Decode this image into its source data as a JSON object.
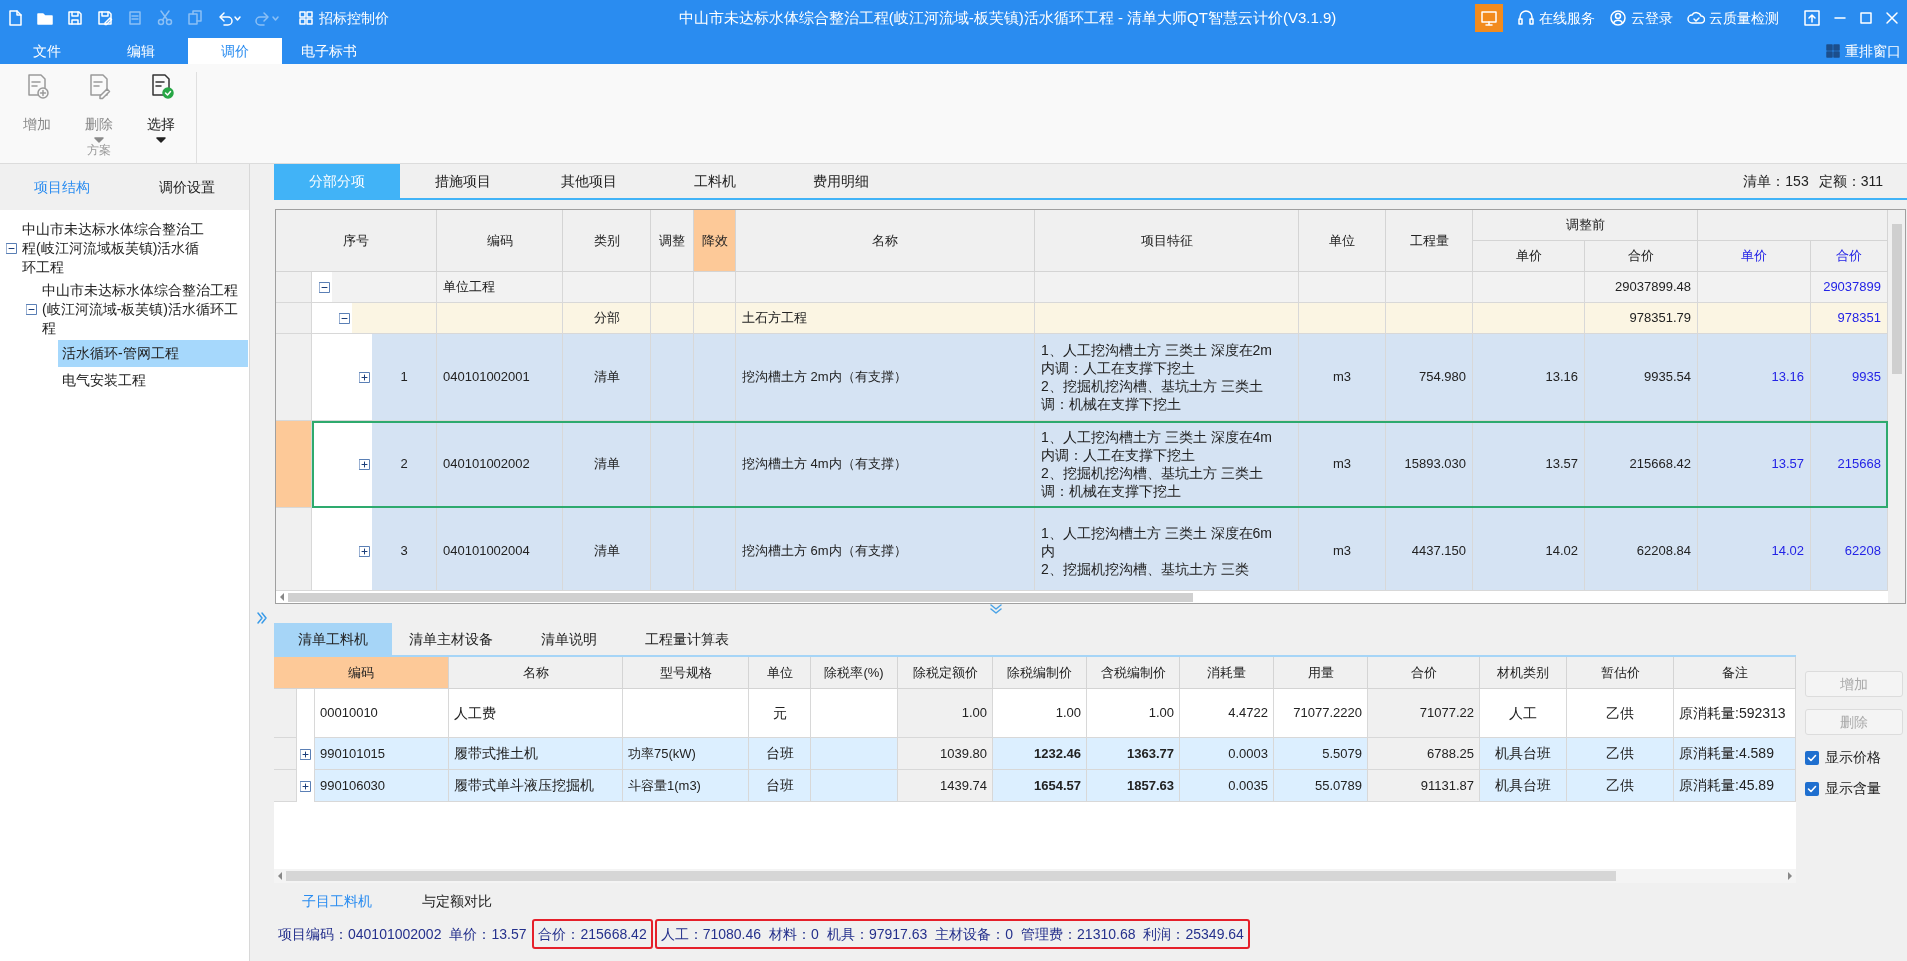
{
  "title_bar": {
    "quick_tools": [
      {
        "kind": "new",
        "disabled": false
      },
      {
        "kind": "open",
        "disabled": false
      },
      {
        "kind": "save",
        "disabled": false
      },
      {
        "kind": "save_as",
        "disabled": false
      },
      {
        "kind": "document",
        "disabled": true
      },
      {
        "kind": "cut",
        "disabled": true
      },
      {
        "kind": "copy",
        "disabled": true
      },
      {
        "kind": "undo",
        "disabled": false
      },
      {
        "kind": "redo",
        "disabled": true
      }
    ],
    "control_price_button": "招标控制价",
    "title": "中山市未达标水体综合整治工程(岐江河流域-板芙镇)活水循环工程 - 清单大师QT智慧云计价(V3.1.9)",
    "links": [
      {
        "kind": "service",
        "label": "在线服务"
      },
      {
        "kind": "login",
        "label": "云登录"
      },
      {
        "kind": "quality",
        "label": "云质量检测"
      }
    ]
  },
  "menu": {
    "tabs": [
      {
        "label": "文件",
        "selected": false
      },
      {
        "label": "编辑",
        "selected": false
      },
      {
        "label": "调价",
        "selected": true
      },
      {
        "label": "电子标书",
        "selected": false
      }
    ],
    "arrange_button": "重排窗口"
  },
  "ribbon": {
    "buttons": [
      {
        "kind": "add",
        "label": "增加",
        "disabled": true,
        "dropdown": false
      },
      {
        "kind": "delete",
        "label": "删除",
        "disabled": true,
        "dropdown": true
      },
      {
        "kind": "select",
        "label": "选择",
        "disabled": false,
        "dropdown": true
      }
    ],
    "group_label": "方案"
  },
  "sidebar": {
    "tabs": [
      {
        "label": "项目结构",
        "selected": true
      },
      {
        "label": "调价设置",
        "selected": false
      }
    ],
    "tree": [
      {
        "label": "中山市未达标水体综合整治工程(岐江河流域板芙镇)活水循环工程",
        "expanded": true,
        "selected": false,
        "children": [
          {
            "label": "中山市未达标水体综合整治工程(岐江河流域-板芙镇)活水循环工程",
            "expanded": true,
            "selected": false,
            "children": [
              {
                "label": "活水循环-管网工程",
                "selected": true
              },
              {
                "label": "电气安装工程",
                "selected": false
              }
            ]
          }
        ]
      }
    ]
  },
  "main_tabs": [
    {
      "label": "分部分项",
      "selected": true
    },
    {
      "label": "措施项目",
      "selected": false
    },
    {
      "label": "其他项目",
      "selected": false
    },
    {
      "label": "工料机",
      "selected": false
    },
    {
      "label": "费用明细",
      "selected": false
    }
  ],
  "counts": [
    "清单：153",
    "定额：311"
  ],
  "table": {
    "columns": [
      {
        "label": "序号",
        "highlighted": false
      },
      {
        "label": "编码",
        "highlighted": false
      },
      {
        "label": "类别",
        "highlighted": false
      },
      {
        "label": "调整",
        "highlighted": false
      },
      {
        "label": "降效",
        "highlighted": true
      },
      {
        "label": "名称",
        "highlighted": false
      },
      {
        "label": "项目特征",
        "highlighted": false
      },
      {
        "label": "单位",
        "highlighted": false
      },
      {
        "label": "工程量",
        "highlighted": false
      }
    ],
    "groups": [
      {
        "kind": "before",
        "label": "调整前",
        "sub": [
          "单价",
          "合价"
        ]
      },
      {
        "kind": "after",
        "sub": [
          "单价",
          "合价"
        ]
      }
    ],
    "rows": [
      {
        "kind": "unit",
        "expanded": true,
        "selected": false,
        "code": "单位工程",
        "total_before": "29037899.48",
        "total_after": "29037899",
        "children": [
          {
            "kind": "division",
            "expanded": true,
            "selected": false,
            "category": "分部",
            "name": "土石方工程",
            "total_before": "978351.79",
            "total_after": "978351",
            "children": [
              {
                "kind": "item",
                "expanded": false,
                "selected": false,
                "seq": "1",
                "code": "040101002001",
                "category": "清单",
                "name": "挖沟槽土方 2m内（有支撑）",
                "features": "1、人工挖沟槽土方 三类土 深度在2m内调：人工在支撑下挖土\n2、挖掘机挖沟槽、基坑土方 三类土调：机械在支撑下挖土",
                "unit": "m3",
                "quantity": "754.980",
                "price_before": "13.16",
                "total_before": "9935.54",
                "price_after": "13.16",
                "total_after": "9935"
              },
              {
                "kind": "item",
                "expanded": false,
                "selected": true,
                "seq": "2",
                "code": "040101002002",
                "category": "清单",
                "name": "挖沟槽土方 4m内（有支撑）",
                "features": "1、人工挖沟槽土方 三类土 深度在4m内调：人工在支撑下挖土\n2、挖掘机挖沟槽、基坑土方 三类土调：机械在支撑下挖土",
                "unit": "m3",
                "quantity": "15893.030",
                "price_before": "13.57",
                "total_before": "215668.42",
                "price_after": "13.57",
                "total_after": "215668"
              },
              {
                "kind": "item",
                "expanded": false,
                "selected": false,
                "seq": "3",
                "code": "040101002004",
                "category": "清单",
                "name": "挖沟槽土方 6m内（有支撑）",
                "features": "1、人工挖沟槽土方 三类土 深度在6m内\n2、挖掘机挖沟槽、基坑土方 三类",
                "unit": "m3",
                "quantity": "4437.150",
                "price_before": "14.02",
                "total_before": "62208.84",
                "price_after": "14.02",
                "total_after": "62208"
              }
            ]
          }
        ]
      }
    ]
  },
  "detail_tabs": [
    {
      "label": "清单工料机",
      "selected": true
    },
    {
      "label": "清单主材设备",
      "selected": false
    },
    {
      "label": "清单说明",
      "selected": false
    },
    {
      "label": "工程量计算表",
      "selected": false
    }
  ],
  "detail_table": {
    "columns": [
      {
        "label": "编码",
        "highlighted": true
      },
      {
        "label": "名称",
        "highlighted": false
      },
      {
        "label": "型号规格",
        "highlighted": false
      },
      {
        "label": "单位",
        "highlighted": false
      },
      {
        "label": "除税率(%)",
        "highlighted": false
      },
      {
        "label": "除税定额价",
        "highlighted": false
      },
      {
        "label": "除税编制价",
        "highlighted": false
      },
      {
        "label": "含税编制价",
        "highlighted": false
      },
      {
        "label": "消耗量",
        "highlighted": false
      },
      {
        "label": "用量",
        "highlighted": false
      },
      {
        "label": "合价",
        "highlighted": false
      },
      {
        "label": "材机类别",
        "highlighted": false
      },
      {
        "label": "暂估价",
        "highlighted": false
      },
      {
        "label": "备注",
        "highlighted": false
      }
    ],
    "rows": [
      {
        "kind": "labor",
        "code": "00010010",
        "name": "人工费",
        "unit": "元",
        "base_price": "1.00",
        "price_ex_tax": "1.00",
        "price_in_tax": "1.00",
        "consumption": "4.4722",
        "usage": "71077.2220",
        "total": "71077.22",
        "material_type": "人工",
        "provisional": "乙供",
        "remark": "原消耗量:592313"
      },
      {
        "kind": "machine",
        "expanded": false,
        "code": "990101015",
        "name": "履带式推土机",
        "spec": "功率75(kW)",
        "unit": "台班",
        "base_price": "1039.80",
        "price_ex_tax": "1232.46",
        "price_in_tax": "1363.77",
        "consumption": "0.0003",
        "usage": "5.5079",
        "total": "6788.25",
        "material_type": "机具台班",
        "provisional": "乙供",
        "remark": "原消耗量:4.589"
      },
      {
        "kind": "machine",
        "expanded": false,
        "code": "990106030",
        "name": "履带式单斗液压挖掘机",
        "spec": "斗容量1(m3)",
        "unit": "台班",
        "base_price": "1439.74",
        "price_ex_tax": "1654.57",
        "price_in_tax": "1857.63",
        "consumption": "0.0035",
        "usage": "55.0789",
        "total": "91131.87",
        "material_type": "机具台班",
        "provisional": "乙供",
        "remark": "原消耗量:45.89"
      }
    ]
  },
  "side_buttons": [
    {
      "label": "增加",
      "disabled": true
    },
    {
      "label": "删除",
      "disabled": true
    }
  ],
  "side_checks": [
    {
      "label": "显示价格",
      "checked": true
    },
    {
      "label": "显示含量",
      "checked": true
    }
  ],
  "footer_tabs": [
    {
      "label": "子目工料机",
      "selected": true
    },
    {
      "label": "与定额对比",
      "selected": false
    }
  ],
  "status_bar": [
    {
      "highlighted": false,
      "items": [
        "项目编码：040101002002",
        "单价：13.57"
      ]
    },
    {
      "highlighted": true,
      "items": [
        "合价：215668.42"
      ]
    },
    {
      "highlighted": true,
      "items": [
        "人工：71080.46",
        "材料：0",
        "机具：97917.63",
        "主材设备：0",
        "管理费：21310.68",
        "利润：25349.64"
      ]
    }
  ]
}
